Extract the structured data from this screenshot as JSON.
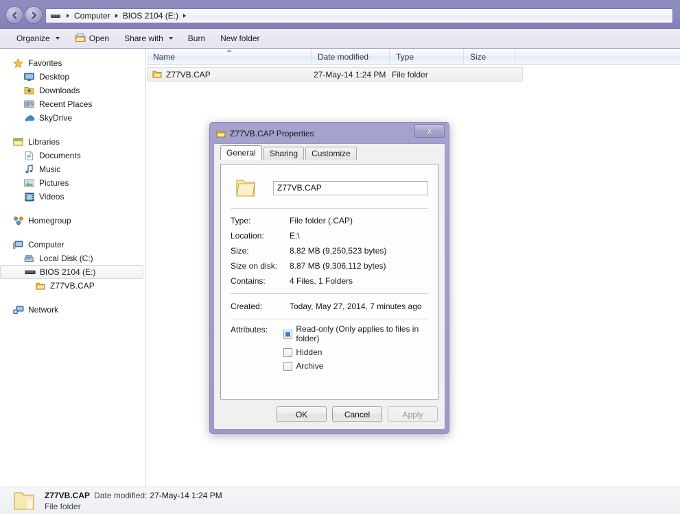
{
  "window": {
    "address": {
      "icon": "computer-drive-icon",
      "crumbs": [
        "Computer",
        "BIOS 2104 (E:)"
      ]
    },
    "nav": {
      "back_label": "Back",
      "forward_label": "Forward",
      "history_label": "Recent pages"
    }
  },
  "toolbar": {
    "items": [
      {
        "label": "Organize",
        "icon": "",
        "has_caret": true
      },
      {
        "label": "Open",
        "icon": "open-folder-icon",
        "has_caret": false
      },
      {
        "label": "Share with",
        "icon": "",
        "has_caret": true
      },
      {
        "label": "Burn",
        "icon": "",
        "has_caret": false
      },
      {
        "label": "New folder",
        "icon": "",
        "has_caret": false
      }
    ]
  },
  "sidebar": {
    "groups": [
      {
        "header": {
          "label": "Favorites",
          "icon": "star-icon"
        },
        "items": [
          {
            "label": "Desktop",
            "icon": "desktop-icon"
          },
          {
            "label": "Downloads",
            "icon": "downloads-icon"
          },
          {
            "label": "Recent Places",
            "icon": "recent-places-icon"
          },
          {
            "label": "SkyDrive",
            "icon": "skydrive-cloud-icon"
          }
        ]
      },
      {
        "header": {
          "label": "Libraries",
          "icon": "libraries-icon"
        },
        "items": [
          {
            "label": "Documents",
            "icon": "document-icon"
          },
          {
            "label": "Music",
            "icon": "music-note-icon"
          },
          {
            "label": "Pictures",
            "icon": "pictures-icon"
          },
          {
            "label": "Videos",
            "icon": "videos-film-icon"
          }
        ]
      },
      {
        "header": {
          "label": "Homegroup",
          "icon": "homegroup-icon"
        },
        "items": []
      },
      {
        "header": {
          "label": "Computer",
          "icon": "computer-icon"
        },
        "items": [
          {
            "label": "Local Disk (C:)",
            "icon": "hard-disk-icon",
            "selected": false
          },
          {
            "label": "BIOS 2104 (E:)",
            "icon": "removable-drive-icon",
            "selected": true
          },
          {
            "label": "Z77VB.CAP",
            "icon": "folder-icon",
            "selected": false,
            "depth": 2
          }
        ]
      },
      {
        "header": {
          "label": "Network",
          "icon": "network-icon"
        },
        "items": []
      }
    ]
  },
  "filelist": {
    "columns": [
      {
        "label": "Name",
        "sorted": true
      },
      {
        "label": "Date modified",
        "sorted": false
      },
      {
        "label": "Type",
        "sorted": false
      },
      {
        "label": "Size",
        "sorted": false
      }
    ],
    "rows": [
      {
        "name": "Z77VB.CAP",
        "date_modified": "27-May-14 1:24 PM",
        "type": "File folder",
        "size": "",
        "icon": "folder-icon",
        "selected": true
      }
    ]
  },
  "statusbar": {
    "icon": "folder-large-icon",
    "name": "Z77VB.CAP",
    "date_label": "Date modified:",
    "date_value": "27-May-14 1:24 PM",
    "type": "File folder"
  },
  "dialog": {
    "icon": "folder-icon",
    "title": "Z77VB.CAP Properties",
    "close_label": "x",
    "tabs": [
      {
        "label": "General",
        "active": true
      },
      {
        "label": "Sharing",
        "active": false
      },
      {
        "label": "Customize",
        "active": false
      }
    ],
    "name_value": "Z77VB.CAP",
    "properties": [
      {
        "key": "Type:",
        "value": "File folder (.CAP)"
      },
      {
        "key": "Location:",
        "value": "E:\\"
      },
      {
        "key": "Size:",
        "value": "8.82 MB (9,250,523 bytes)"
      },
      {
        "key": "Size on disk:",
        "value": "8.87 MB (9,306,112 bytes)"
      },
      {
        "key": "Contains:",
        "value": "4 Files, 1 Folders"
      }
    ],
    "created": {
      "key": "Created:",
      "value": "Today, May 27, 2014, 7 minutes ago"
    },
    "attributes": {
      "key": "Attributes:",
      "items": [
        {
          "label": "Read-only (Only applies to files in folder)",
          "state": "indeterminate"
        },
        {
          "label": "Hidden",
          "state": "unchecked"
        },
        {
          "label": "Archive",
          "state": "unchecked"
        }
      ]
    },
    "buttons": [
      {
        "label": "OK",
        "disabled": false
      },
      {
        "label": "Cancel",
        "disabled": false
      },
      {
        "label": "Apply",
        "disabled": true
      }
    ]
  },
  "colors": {
    "chrome_purple": "#8b88bd",
    "accent_blue": "#2b6cb0",
    "folder_yellow": "#f5d776"
  }
}
